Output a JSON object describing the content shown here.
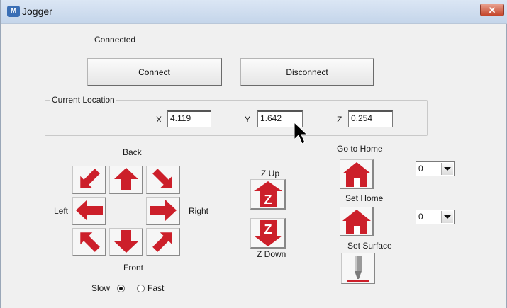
{
  "window": {
    "title": "Jogger",
    "close_label": "✕"
  },
  "status": {
    "text": "Connected"
  },
  "buttons": {
    "connect": "Connect",
    "disconnect": "Disconnect"
  },
  "location": {
    "group_label": "Current Location",
    "x_label": "X",
    "x_value": "4.119",
    "y_label": "Y",
    "y_value": "1.642",
    "z_label": "Z",
    "z_value": "0.254"
  },
  "jog": {
    "back_label": "Back",
    "front_label": "Front",
    "left_label": "Left",
    "right_label": "Right"
  },
  "z_axis": {
    "up_label": "Z Up",
    "down_label": "Z Down"
  },
  "home": {
    "go_label": "Go to Home",
    "go_select": "0",
    "set_label": "Set Home",
    "set_select": "0",
    "surface_label": "Set Surface"
  },
  "speed": {
    "slow_label": "Slow",
    "fast_label": "Fast",
    "selected": "Slow"
  },
  "colors": {
    "accent_red": "#cc1f2a",
    "titlebar": "#c4d5ea"
  },
  "icons": [
    "app-icon",
    "close-icon",
    "arrow-icons",
    "z-icons",
    "house-icons",
    "probe-icon",
    "mouse-pointer-icon"
  ]
}
